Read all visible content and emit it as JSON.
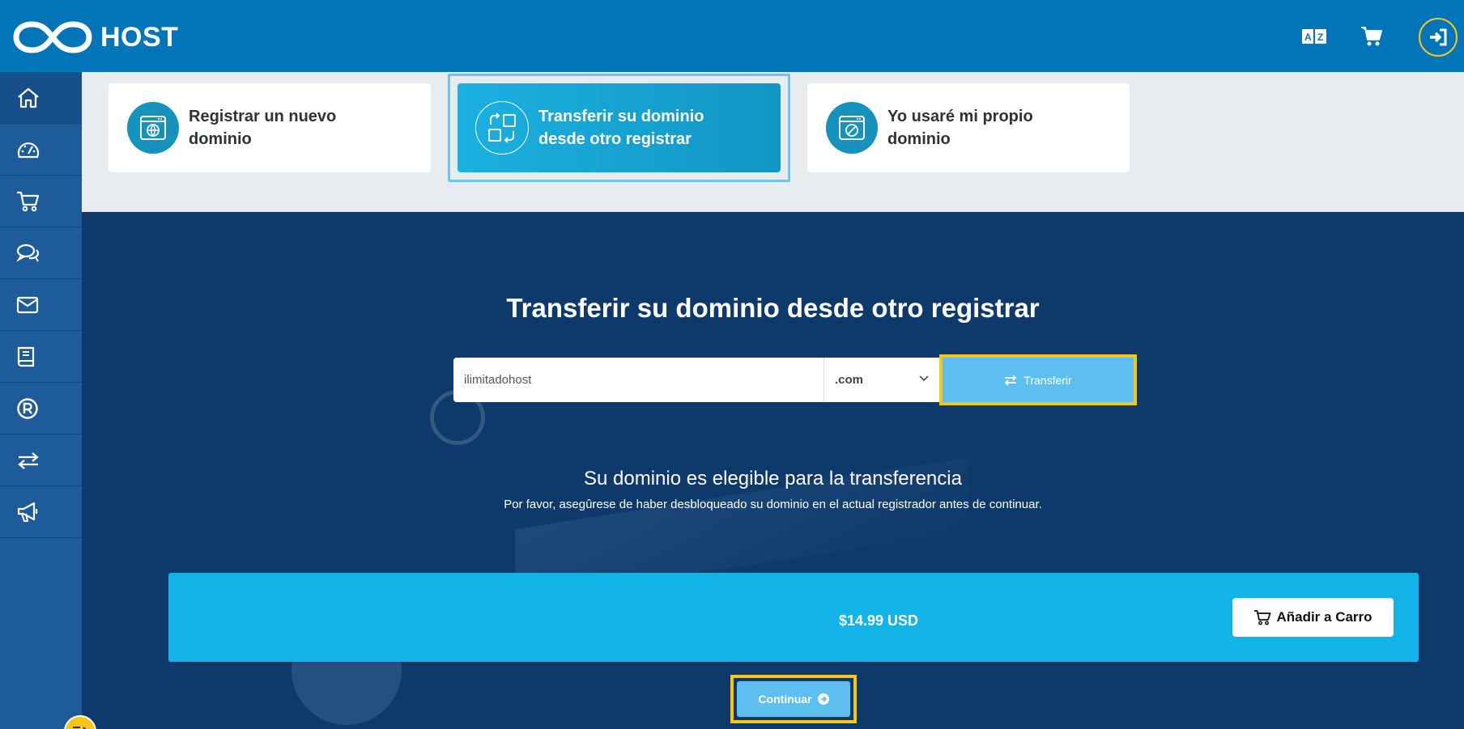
{
  "header": {
    "brand": "HOST",
    "icons": [
      "translate-icon",
      "cart-icon",
      "login-icon"
    ]
  },
  "sidebar": {
    "items": [
      {
        "icon": "home-icon"
      },
      {
        "icon": "dashboard-icon"
      },
      {
        "icon": "cart-icon"
      },
      {
        "icon": "chat-icon"
      },
      {
        "icon": "mail-icon"
      },
      {
        "icon": "book-icon"
      },
      {
        "icon": "registered-icon"
      },
      {
        "icon": "transfer-icon"
      },
      {
        "icon": "megaphone-icon"
      }
    ]
  },
  "options": {
    "register": "Registrar un nuevo dominio",
    "transfer": "Transferir su dominio desde otro registrar",
    "own": "Yo usaré mi propio dominio"
  },
  "main": {
    "title": "Transferir su dominio desde otro registrar",
    "domain_value": "ilimitadohost",
    "tld": ".com",
    "transfer_label": "Transferir",
    "eligible_title": "Su dominio es elegible para la transferencia",
    "eligible_sub": "Por favor, asegûrese de haber desbloqueado su dominio en el actual registrador antes de continuar.",
    "price": "$14.99 USD",
    "cart_label": "Añadir a Carro",
    "continue_label": "Continuar"
  },
  "colors": {
    "header": "#0175b8",
    "sidebar": "#1e5b9a",
    "main_bg": "#0e3a6b",
    "accent": "#12b3e6",
    "highlight": "#f5c518",
    "button": "#5cbff0"
  }
}
